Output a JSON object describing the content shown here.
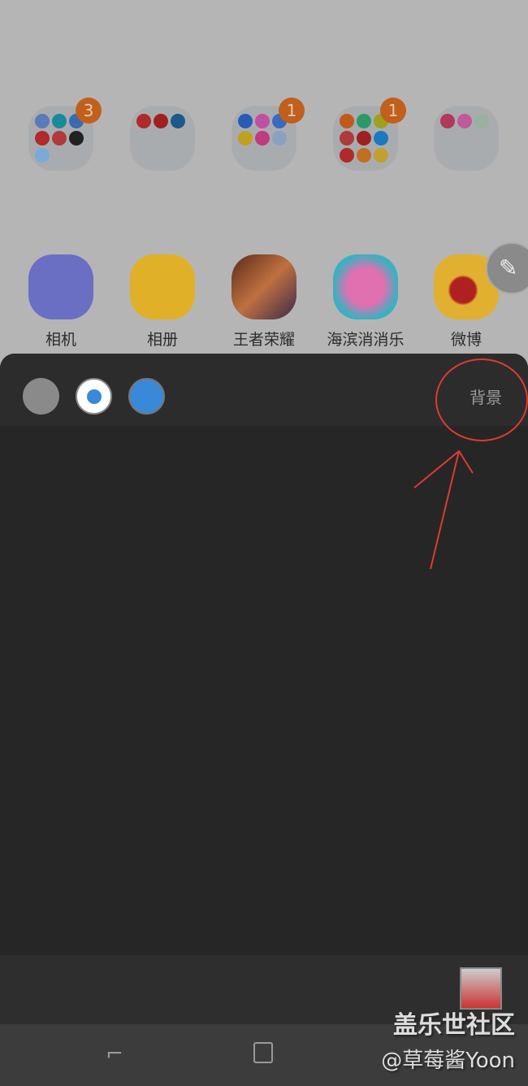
{
  "folders": [
    {
      "badge": "3"
    },
    {
      "badge": ""
    },
    {
      "badge": "1"
    },
    {
      "badge": "1"
    },
    {
      "badge": ""
    }
  ],
  "apps": [
    {
      "label": "相机",
      "icon": "camera-icon",
      "color": "#6a6fc4"
    },
    {
      "label": "相册",
      "icon": "gallery-icon",
      "color": "#e0b028"
    },
    {
      "label": "王者荣耀",
      "icon": "game-icon",
      "color": "#8a4a2a"
    },
    {
      "label": "海滨消消乐",
      "icon": "game-icon",
      "color": "#3db0c0"
    },
    {
      "label": "微博",
      "icon": "weibo-icon",
      "color": "#e2b030"
    }
  ],
  "toolbar": {
    "background_label": "背景",
    "pen_color": "#3a88d8"
  },
  "watermark": {
    "site": "盖乐世社区",
    "user": "@草莓酱Yoon"
  },
  "annotation_color": "#e03a30"
}
